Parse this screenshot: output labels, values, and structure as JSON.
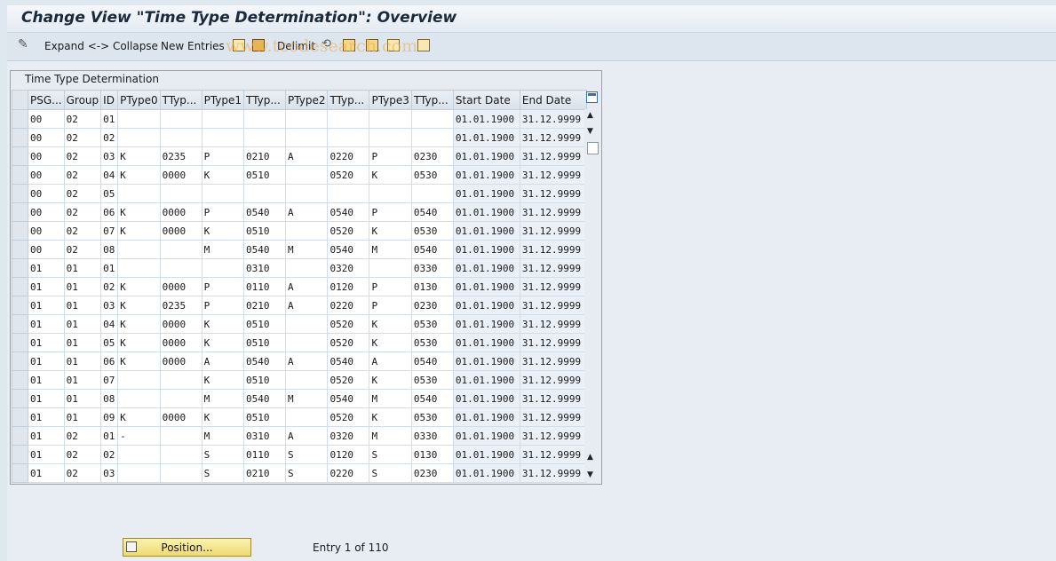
{
  "window": {
    "title": "Change View \"Time Type Determination\": Overview"
  },
  "toolbar": {
    "expand_collapse": "Expand <-> Collapse",
    "new_entries": "New Entries",
    "delimit": "Delimit"
  },
  "watermark": "www.tcodesearch.com",
  "table": {
    "title": "Time Type Determination",
    "columns": [
      "PSG...",
      "Group",
      "ID",
      "PType0",
      "TTyp...",
      "PType1",
      "TTyp...",
      "PType2",
      "TTyp...",
      "PType3",
      "TTyp...",
      "Start Date",
      "End Date"
    ],
    "rows": [
      [
        "00",
        "02",
        "01",
        "",
        "",
        "",
        "",
        "",
        "",
        "",
        "",
        "01.01.1900",
        "31.12.9999"
      ],
      [
        "00",
        "02",
        "02",
        "",
        "",
        "",
        "",
        "",
        "",
        "",
        "",
        "01.01.1900",
        "31.12.9999"
      ],
      [
        "00",
        "02",
        "03",
        "K",
        "0235",
        "P",
        "0210",
        "A",
        "0220",
        "P",
        "0230",
        "01.01.1900",
        "31.12.9999"
      ],
      [
        "00",
        "02",
        "04",
        "K",
        "0000",
        "K",
        "0510",
        "",
        "0520",
        "K",
        "0530",
        "01.01.1900",
        "31.12.9999"
      ],
      [
        "00",
        "02",
        "05",
        "",
        "",
        "",
        "",
        "",
        "",
        "",
        "",
        "01.01.1900",
        "31.12.9999"
      ],
      [
        "00",
        "02",
        "06",
        "K",
        "0000",
        "P",
        "0540",
        "A",
        "0540",
        "P",
        "0540",
        "01.01.1900",
        "31.12.9999"
      ],
      [
        "00",
        "02",
        "07",
        "K",
        "0000",
        "K",
        "0510",
        "",
        "0520",
        "K",
        "0530",
        "01.01.1900",
        "31.12.9999"
      ],
      [
        "00",
        "02",
        "08",
        "",
        "",
        "M",
        "0540",
        "M",
        "0540",
        "M",
        "0540",
        "01.01.1900",
        "31.12.9999"
      ],
      [
        "01",
        "01",
        "01",
        "",
        "",
        "",
        "0310",
        "",
        "0320",
        "",
        "0330",
        "01.01.1900",
        "31.12.9999"
      ],
      [
        "01",
        "01",
        "02",
        "K",
        "0000",
        "P",
        "0110",
        "A",
        "0120",
        "P",
        "0130",
        "01.01.1900",
        "31.12.9999"
      ],
      [
        "01",
        "01",
        "03",
        "K",
        "0235",
        "P",
        "0210",
        "A",
        "0220",
        "P",
        "0230",
        "01.01.1900",
        "31.12.9999"
      ],
      [
        "01",
        "01",
        "04",
        "K",
        "0000",
        "K",
        "0510",
        "",
        "0520",
        "K",
        "0530",
        "01.01.1900",
        "31.12.9999"
      ],
      [
        "01",
        "01",
        "05",
        "K",
        "0000",
        "K",
        "0510",
        "",
        "0520",
        "K",
        "0530",
        "01.01.1900",
        "31.12.9999"
      ],
      [
        "01",
        "01",
        "06",
        "K",
        "0000",
        "A",
        "0540",
        "A",
        "0540",
        "A",
        "0540",
        "01.01.1900",
        "31.12.9999"
      ],
      [
        "01",
        "01",
        "07",
        "",
        "",
        "K",
        "0510",
        "",
        "0520",
        "K",
        "0530",
        "01.01.1900",
        "31.12.9999"
      ],
      [
        "01",
        "01",
        "08",
        "",
        "",
        "M",
        "0540",
        "M",
        "0540",
        "M",
        "0540",
        "01.01.1900",
        "31.12.9999"
      ],
      [
        "01",
        "01",
        "09",
        "K",
        "0000",
        "K",
        "0510",
        "",
        "0520",
        "K",
        "0530",
        "01.01.1900",
        "31.12.9999"
      ],
      [
        "01",
        "02",
        "01",
        "-",
        "",
        "M",
        "0310",
        "A",
        "0320",
        "M",
        "0330",
        "01.01.1900",
        "31.12.9999"
      ],
      [
        "01",
        "02",
        "02",
        "",
        "",
        "S",
        "0110",
        "S",
        "0120",
        "S",
        "0130",
        "01.01.1900",
        "31.12.9999"
      ],
      [
        "01",
        "02",
        "03",
        "",
        "",
        "S",
        "0210",
        "S",
        "0220",
        "S",
        "0230",
        "01.01.1900",
        "31.12.9999"
      ]
    ]
  },
  "footer": {
    "position_button": "Position...",
    "entry_info": "Entry 1 of 110"
  }
}
